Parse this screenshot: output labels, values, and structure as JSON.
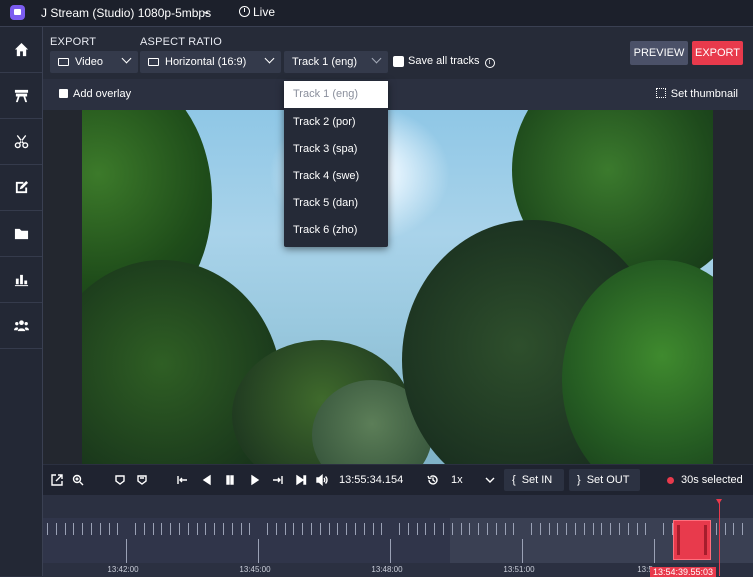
{
  "topbar": {
    "stream_title": "J Stream (Studio) 1080p-5mbps",
    "live_label": "Live"
  },
  "sidebar": {
    "items": [
      {
        "icon": "home-icon"
      },
      {
        "icon": "clapperboard-icon"
      },
      {
        "icon": "scissors-icon"
      },
      {
        "icon": "edit-icon"
      },
      {
        "icon": "folder-icon"
      },
      {
        "icon": "bar-chart-icon"
      },
      {
        "icon": "users-icon"
      }
    ]
  },
  "toolbar": {
    "export_label": "EXPORT",
    "aspect_label": "ASPECT RATIO",
    "export_type": "Video",
    "aspect_value": "Horizontal (16:9)",
    "track_value": "Track 1 (eng)",
    "save_all_tracks": "Save all tracks",
    "save_all_checked": false,
    "preview_button": "PREVIEW",
    "export_button": "EXPORT"
  },
  "overlay_bar": {
    "add_overlay": "Add overlay",
    "set_thumbnail": "Set thumbnail"
  },
  "dropdown": {
    "options": [
      "Track 1 (eng)",
      "Track 2 (por)",
      "Track 3 (spa)",
      "Track 4 (swe)",
      "Track 5 (dan)",
      "Track 6 (zho)"
    ],
    "selected_index": 0
  },
  "controls": {
    "time": "13:55:34.154",
    "speed": "1x",
    "set_in": "Set IN",
    "set_out": "Set OUT",
    "selected": "30s selected"
  },
  "timeline": {
    "tick_labels": [
      "13:42:00",
      "13:45:00",
      "13:48:00",
      "13:51:00",
      "13:5"
    ],
    "playhead_label": "13:54:39.55:03"
  },
  "colors": {
    "accent": "#e83a4c",
    "brand": "#7b5cf0",
    "panel": "#262b38"
  }
}
